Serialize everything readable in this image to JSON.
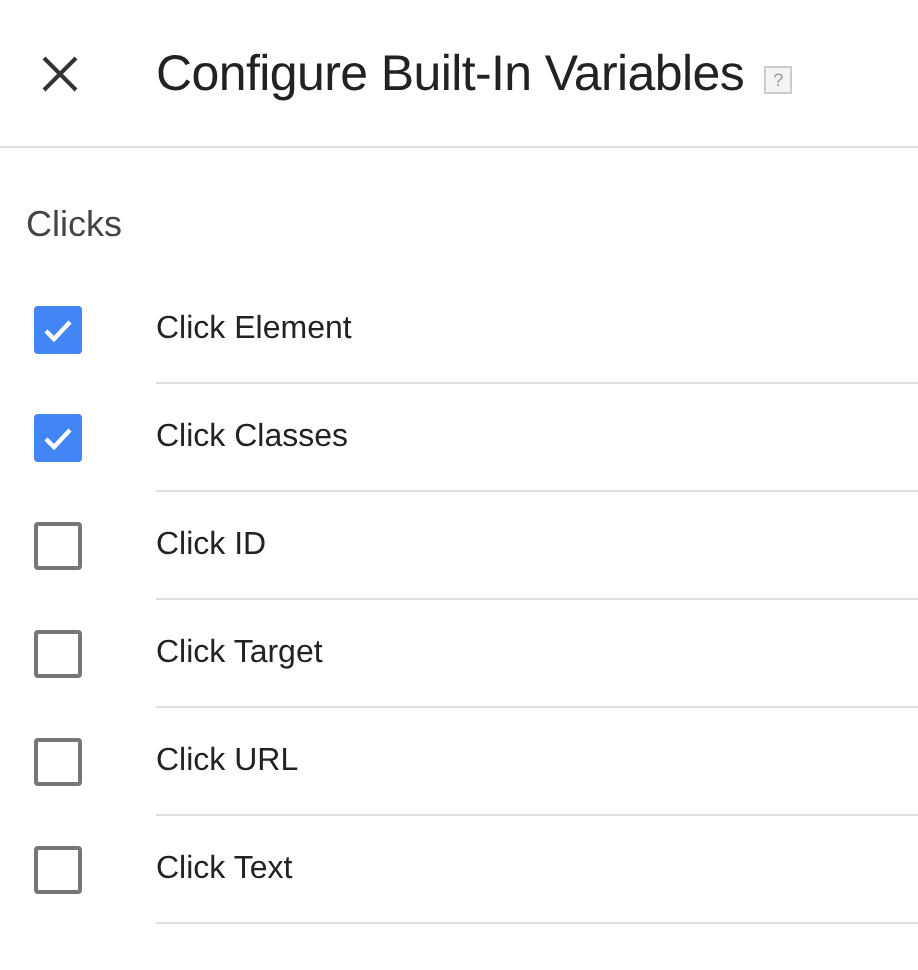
{
  "window": {
    "title": "Configure Built-In Variables",
    "help": "?"
  },
  "section": {
    "title": "Clicks"
  },
  "variables": [
    {
      "label": "Click Element",
      "checked": true
    },
    {
      "label": "Click Classes",
      "checked": true
    },
    {
      "label": "Click ID",
      "checked": false
    },
    {
      "label": "Click Target",
      "checked": false
    },
    {
      "label": "Click URL",
      "checked": false
    },
    {
      "label": "Click Text",
      "checked": false
    }
  ]
}
